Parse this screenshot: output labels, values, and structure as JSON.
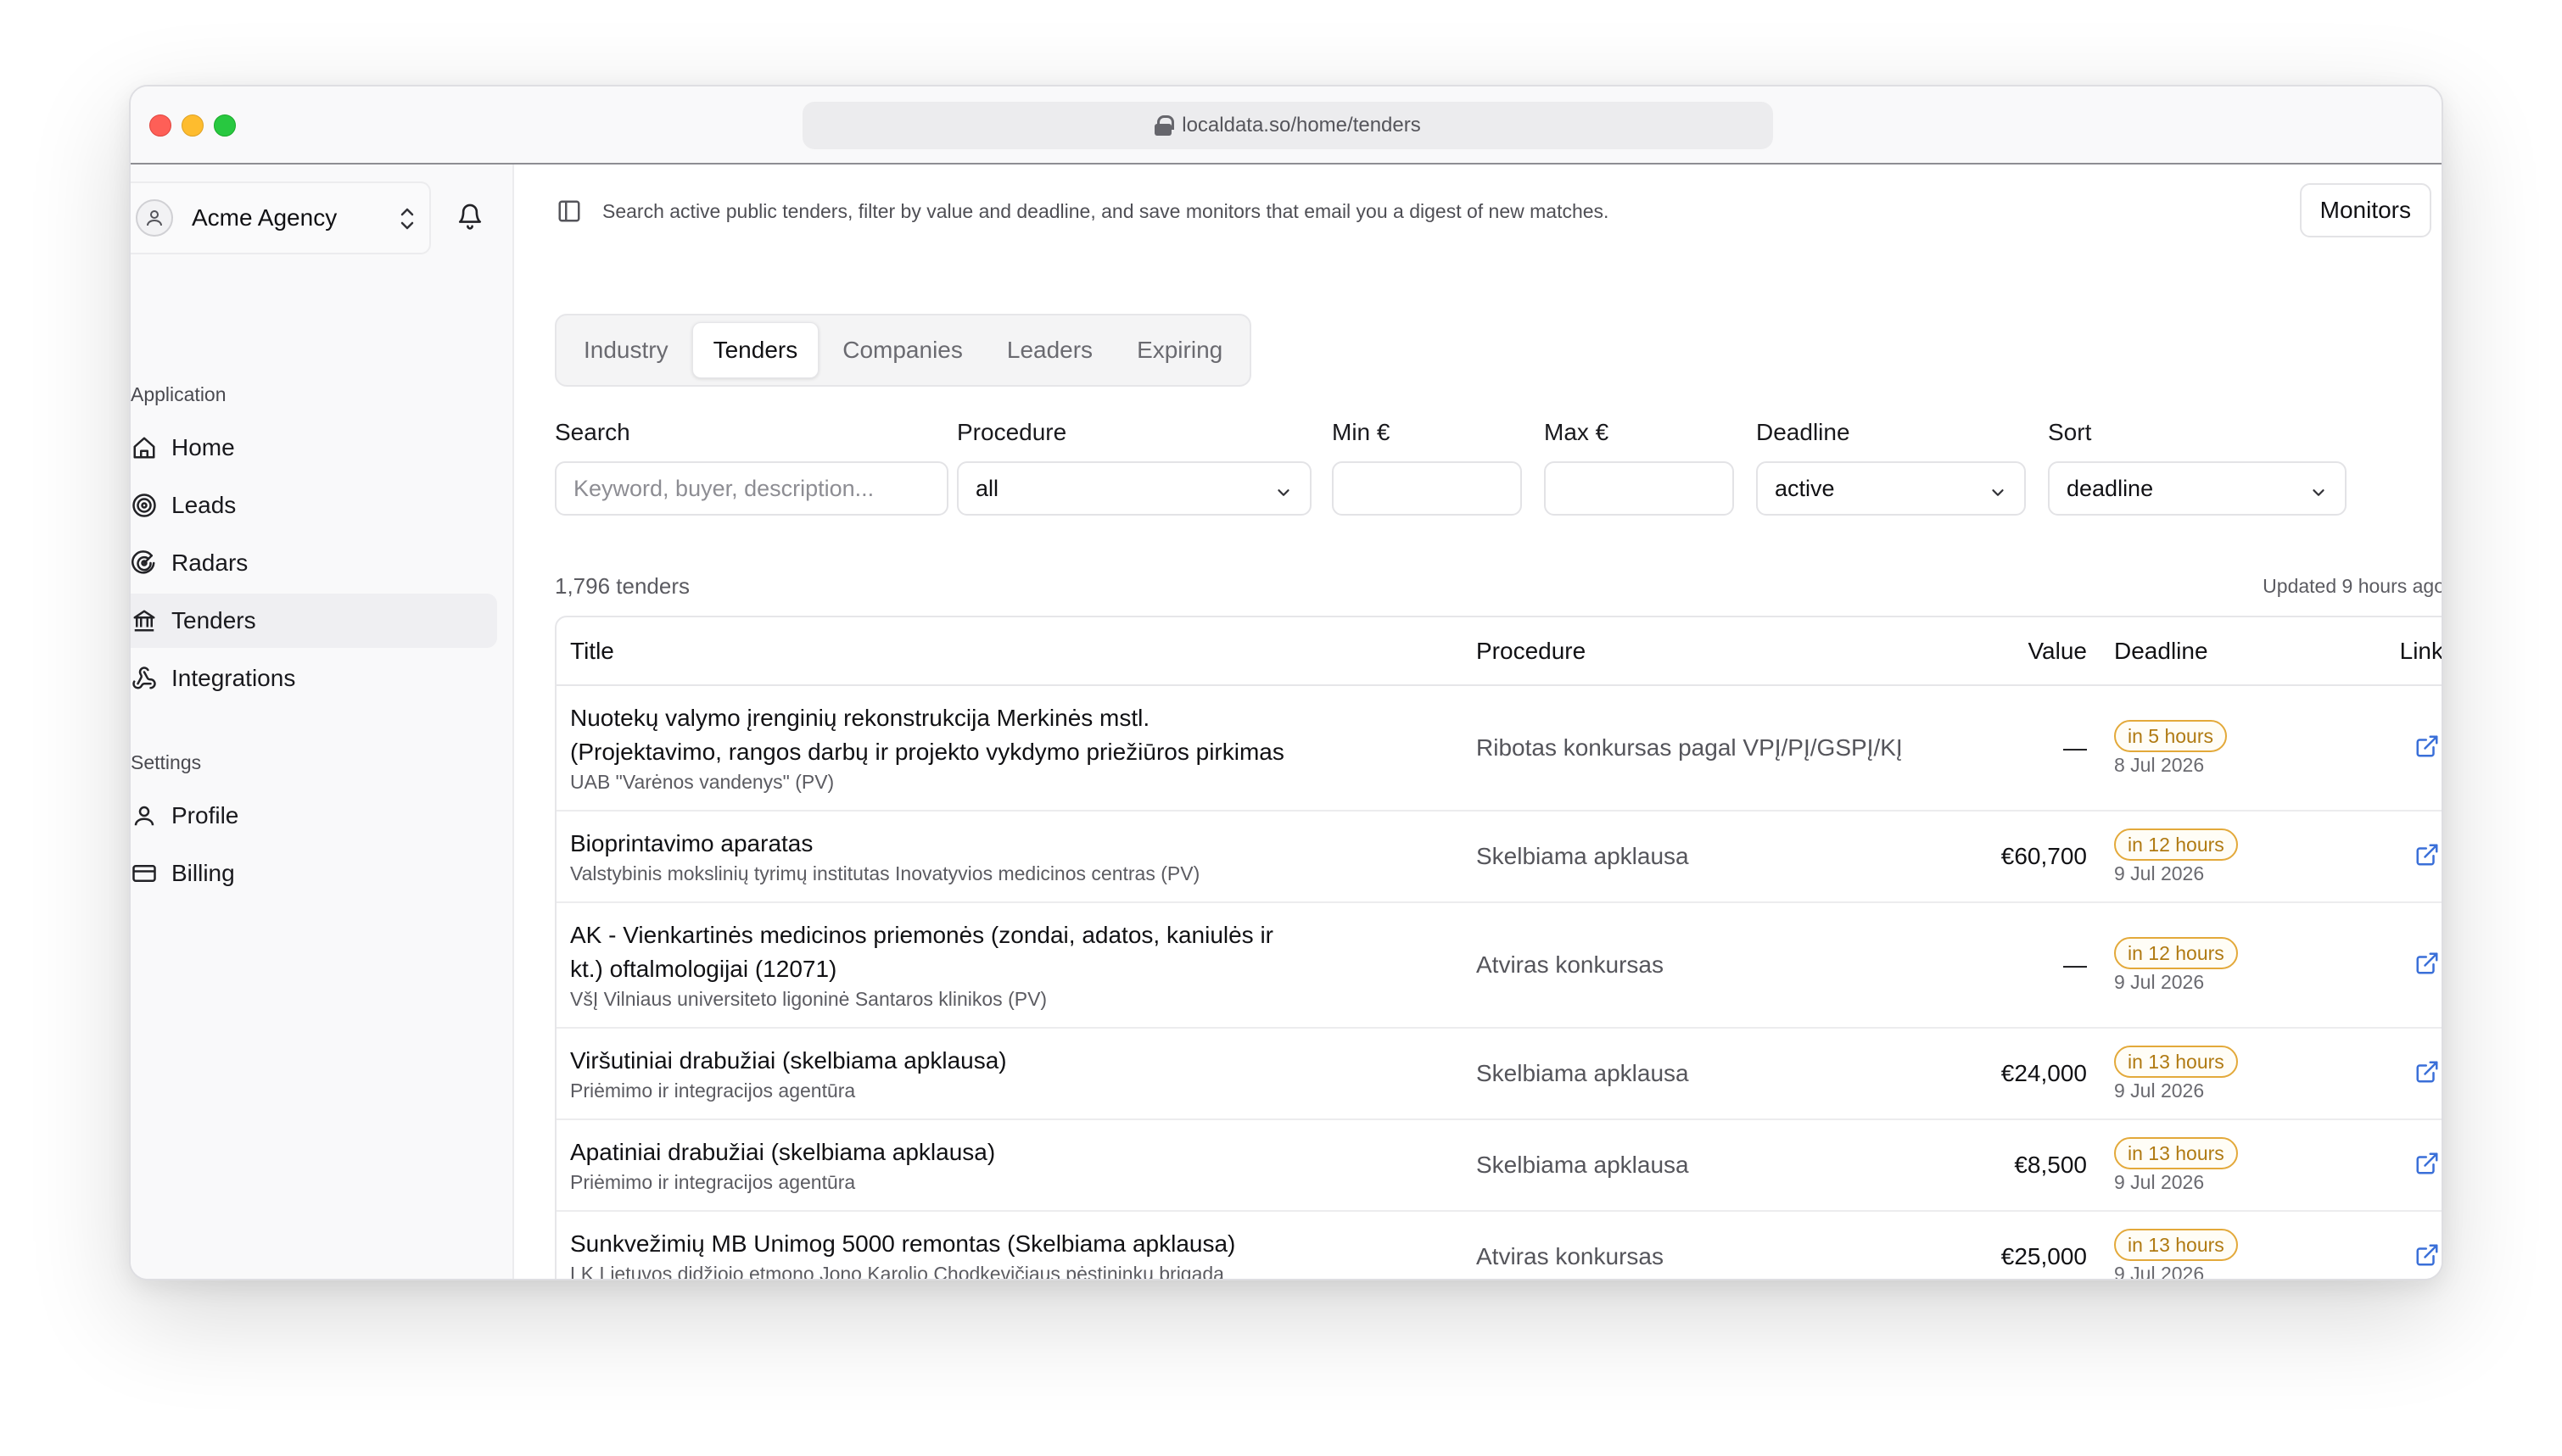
{
  "browser": {
    "url": "localdata.so/home/tenders"
  },
  "sidebar": {
    "org_name": "Acme Agency",
    "sections": [
      {
        "label": "Application"
      },
      {
        "label": "Settings"
      }
    ],
    "app_items": [
      {
        "label": "Home",
        "icon": "home-icon"
      },
      {
        "label": "Leads",
        "icon": "target-icon"
      },
      {
        "label": "Radars",
        "icon": "radar-icon"
      },
      {
        "label": "Tenders",
        "icon": "landmark-icon",
        "active": true
      },
      {
        "label": "Integrations",
        "icon": "webhook-icon"
      }
    ],
    "settings_items": [
      {
        "label": "Profile",
        "icon": "user-icon"
      },
      {
        "label": "Billing",
        "icon": "credit-card-icon"
      }
    ]
  },
  "header": {
    "subtitle": "Search active public tenders, filter by value and deadline, and save monitors that email you a digest of new matches.",
    "monitors_label": "Monitors"
  },
  "tabs": [
    {
      "label": "Industry"
    },
    {
      "label": "Tenders",
      "active": true
    },
    {
      "label": "Companies"
    },
    {
      "label": "Leaders"
    },
    {
      "label": "Expiring"
    }
  ],
  "filters": {
    "search": {
      "label": "Search",
      "placeholder": "Keyword, buyer, description..."
    },
    "procedure": {
      "label": "Procedure",
      "value": "all"
    },
    "min": {
      "label": "Min €",
      "value": ""
    },
    "max": {
      "label": "Max €",
      "value": ""
    },
    "deadline": {
      "label": "Deadline",
      "value": "active"
    },
    "sort": {
      "label": "Sort",
      "value": "deadline"
    }
  },
  "results": {
    "count": "1,796 tenders",
    "updated": "Updated 9 hours ago"
  },
  "table": {
    "columns": {
      "title": "Title",
      "procedure": "Procedure",
      "value": "Value",
      "deadline": "Deadline",
      "link": "Link"
    },
    "rows": [
      {
        "title_lines": [
          "Nuotekų valymo įrenginių rekonstrukcija Merkinės mstl.",
          "(Projektavimo, rangos darbų ir projekto vykdymo priežiūros pirkimas"
        ],
        "buyer": "UAB \"Varėnos vandenys\" (PV)",
        "procedure": "Ribotas konkursas pagal VPĮ/PĮ/GSPĮ/KĮ",
        "value": "—",
        "badge": "in 5 hours",
        "date": "8 Jul 2026"
      },
      {
        "title_lines": [
          "Bioprintavimo aparatas"
        ],
        "buyer": "Valstybinis mokslinių tyrimų institutas Inovatyvios medicinos centras (PV)",
        "procedure": "Skelbiama apklausa",
        "value": "€60,700",
        "badge": "in 12 hours",
        "date": "9 Jul 2026"
      },
      {
        "title_lines": [
          "AK - Vienkartinės medicinos priemonės (zondai, adatos, kaniulės ir",
          "kt.) oftalmologijai (12071)"
        ],
        "buyer": "VšĮ Vilniaus universiteto ligoninė Santaros klinikos (PV)",
        "procedure": "Atviras konkursas",
        "value": "—",
        "badge": "in 12 hours",
        "date": "9 Jul 2026"
      },
      {
        "title_lines": [
          "Viršutiniai drabužiai (skelbiama apklausa)"
        ],
        "buyer": "Priėmimo ir integracijos agentūra",
        "procedure": "Skelbiama apklausa",
        "value": "€24,000",
        "badge": "in 13 hours",
        "date": "9 Jul 2026"
      },
      {
        "title_lines": [
          "Apatiniai drabužiai (skelbiama apklausa)"
        ],
        "buyer": "Priėmimo ir integracijos agentūra",
        "procedure": "Skelbiama apklausa",
        "value": "€8,500",
        "badge": "in 13 hours",
        "date": "9 Jul 2026"
      },
      {
        "title_lines": [
          "Sunkvežimių MB Unimog 5000 remontas (Skelbiama apklausa)"
        ],
        "buyer": "LK Lietuvos didžiojo etmono Jono Karolio Chodkevičiaus pėstininkų brigada",
        "procedure": "Atviras konkursas",
        "value": "€25,000",
        "badge": "in 13 hours",
        "date": "9 Jul 2026"
      }
    ]
  },
  "colors": {
    "badge_border": "#e3a93a",
    "badge_text": "#b07a12",
    "active_nav": "#efeff2"
  }
}
